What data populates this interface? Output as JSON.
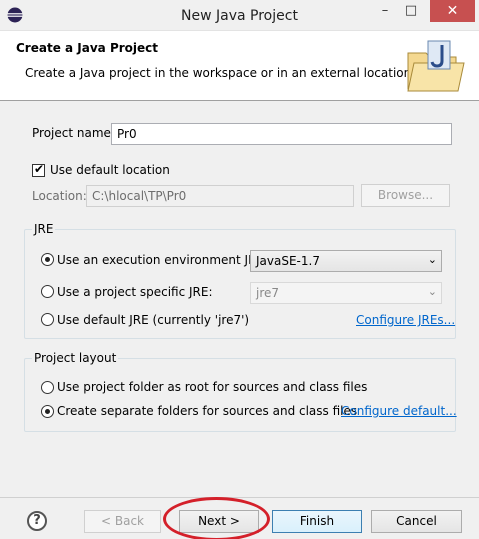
{
  "window": {
    "title": "New Java Project",
    "minimize_glyph": "–",
    "maximize_glyph": "□",
    "close_glyph": "✕"
  },
  "banner": {
    "title": "Create a Java Project",
    "description": "Create a Java project in the workspace or in an external location."
  },
  "project": {
    "name_label": "Project name:",
    "name_value": "Pr0",
    "use_default_label": "Use default location",
    "use_default_checked": true,
    "location_label": "Location:",
    "location_value": "C:\\hlocal\\TP\\Pr0",
    "browse_label": "Browse..."
  },
  "jre": {
    "group_title": "JRE",
    "option_env_label": "Use an execution environment JRE:",
    "option_env_value": "JavaSE-1.7",
    "option_specific_label": "Use a project specific JRE:",
    "option_specific_value": "jre7",
    "option_default_label": "Use default JRE (currently 'jre7')",
    "configure_link": "Configure JREs..."
  },
  "layout": {
    "group_title": "Project layout",
    "option_root_label": "Use project folder as root for sources and class files",
    "option_separate_label": "Create separate folders for sources and class files",
    "configure_link": "Configure default..."
  },
  "footer": {
    "help_glyph": "?",
    "back_label": "< Back",
    "next_label": "Next >",
    "finish_label": "Finish",
    "cancel_label": "Cancel"
  },
  "colors": {
    "highlight_oval": "#d4202a",
    "link": "#0066cc",
    "close_button": "#c75050"
  }
}
